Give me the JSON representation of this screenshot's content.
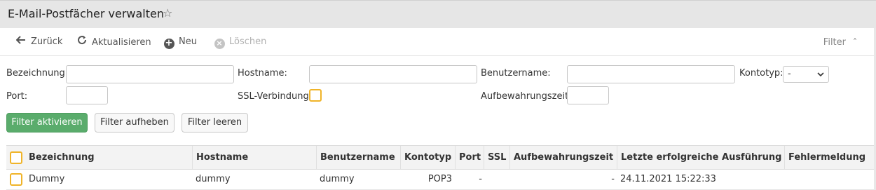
{
  "window": {
    "title": "E-Mail-Postfächer verwalten",
    "favorite_icon": "star-outline-icon"
  },
  "toolbar": {
    "back_label": "Zurück",
    "refresh_label": "Aktualisieren",
    "new_label": "Neu",
    "delete_label": "Löschen",
    "filter_label": "Filter"
  },
  "filter": {
    "bezeichnung_label": "Bezeichnung:",
    "bezeichnung_value": "",
    "hostname_label": "Hostname:",
    "hostname_value": "",
    "benutzername_label": "Benutzername:",
    "benutzername_value": "",
    "kontotyp_label": "Kontotyp:",
    "kontotyp_value": "-",
    "port_label": "Port:",
    "port_value": "",
    "ssl_label": "SSL-Verbindung:",
    "ssl_checked": false,
    "aufbewahrung_label": "Aufbewahrungszeit:",
    "aufbewahrung_value": "",
    "apply_label": "Filter aktivieren",
    "remove_label": "Filter aufheben",
    "clear_label": "Filter leeren"
  },
  "table": {
    "columns": [
      "Bezeichnung",
      "Hostname",
      "Benutzername",
      "Kontotyp",
      "Port",
      "SSL",
      "Aufbewahrungszeit",
      "Letzte erfolgreiche Ausführung",
      "Fehlermeldung"
    ],
    "rows": [
      {
        "bezeichnung": "Dummy",
        "hostname": "dummy",
        "benutzername": "dummy",
        "kontotyp": "POP3",
        "port": "-",
        "ssl": "",
        "aufbewahrung": "-",
        "letzte_ausfuehrung": "24.11.2021 15:22:33",
        "fehlermeldung": ""
      }
    ]
  },
  "colors": {
    "accent_green": "#5aac6c",
    "checkbox_border": "#f0b429"
  }
}
